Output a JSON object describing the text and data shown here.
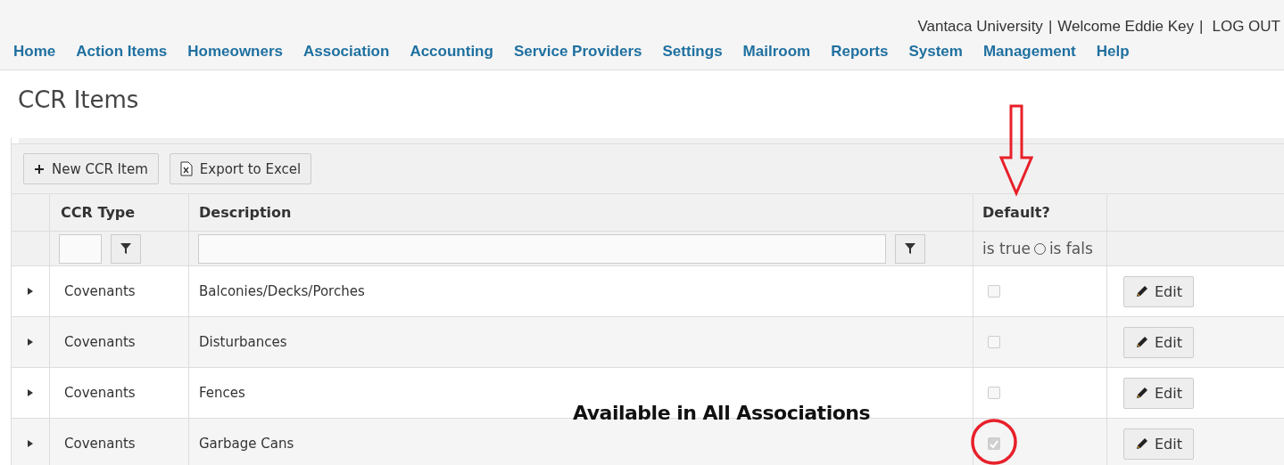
{
  "top_bar": {
    "org": "Vantaca University",
    "separator": "|",
    "welcome": "Welcome Eddie Key",
    "logout": "LOG OUT"
  },
  "nav": [
    "Home",
    "Action Items",
    "Homeowners",
    "Association",
    "Accounting",
    "Service Providers",
    "Settings",
    "Mailroom",
    "Reports",
    "System",
    "Management",
    "Help"
  ],
  "page_title": "CCR Items",
  "toolbar": [
    {
      "kind": "add",
      "label": "New CCR Item"
    },
    {
      "kind": "excel",
      "label": "Export to Excel"
    }
  ],
  "columns": [
    "CCR Type",
    "Description",
    "Default?"
  ],
  "default_filter": {
    "true_label": "is true",
    "false_selected": false,
    "false_label": "is fals"
  },
  "rows": [
    {
      "type": "Covenants",
      "description": "Balconies/Decks/Porches",
      "default": false,
      "action": "Edit"
    },
    {
      "type": "Covenants",
      "description": "Disturbances",
      "default": false,
      "action": "Edit"
    },
    {
      "type": "Covenants",
      "description": "Fences",
      "default": false,
      "action": "Edit"
    },
    {
      "type": "Covenants",
      "description": "Garbage Cans",
      "default": true,
      "action": "Edit"
    }
  ],
  "annotation": {
    "text": "Available in All Associations"
  }
}
